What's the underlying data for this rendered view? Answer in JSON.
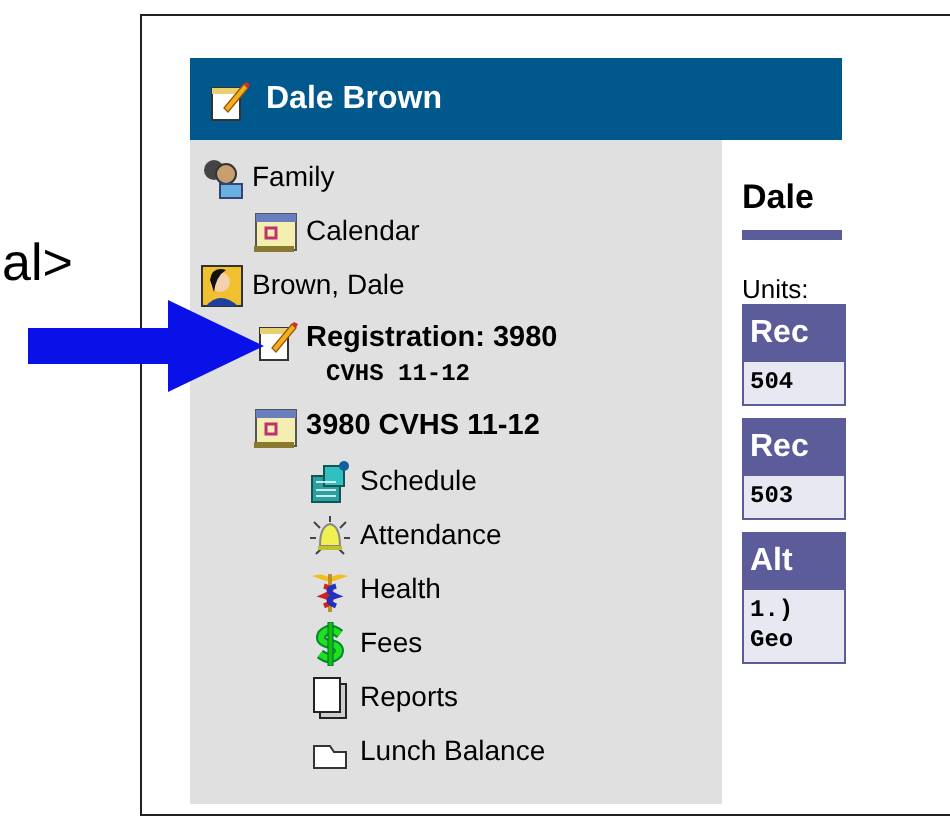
{
  "annotation_text": "al>",
  "header": {
    "title": "Dale Brown"
  },
  "sidebar": {
    "items": [
      {
        "kind": "family",
        "label": "Family",
        "bold": false,
        "children": [
          {
            "kind": "calendar",
            "label": "Calendar",
            "bold": false
          }
        ]
      },
      {
        "kind": "student",
        "label": "Brown, Dale",
        "bold": false,
        "children": [
          {
            "kind": "registration",
            "label": "Registration: 3980",
            "sublabel": "CVHS 11-12",
            "bold": true
          },
          {
            "kind": "calendar",
            "label": "3980 CVHS 11-12",
            "bold": true,
            "children": [
              {
                "kind": "schedule",
                "label": "Schedule",
                "bold": false
              },
              {
                "kind": "attendance",
                "label": "Attendance",
                "bold": false
              },
              {
                "kind": "health",
                "label": "Health",
                "bold": false
              },
              {
                "kind": "fees",
                "label": "Fees",
                "bold": false
              },
              {
                "kind": "reports",
                "label": "Reports",
                "bold": false
              },
              {
                "kind": "lunch",
                "label": "Lunch Balance",
                "bold": false
              }
            ]
          }
        ]
      }
    ]
  },
  "content": {
    "heading": "Dale",
    "units_label": "Units:",
    "boxes": [
      {
        "title": "Rec",
        "lines": [
          "504"
        ]
      },
      {
        "title": "Rec",
        "lines": [
          "503"
        ]
      },
      {
        "title": "Alt",
        "lines": [
          "1.)",
          "Geo"
        ]
      }
    ]
  }
}
